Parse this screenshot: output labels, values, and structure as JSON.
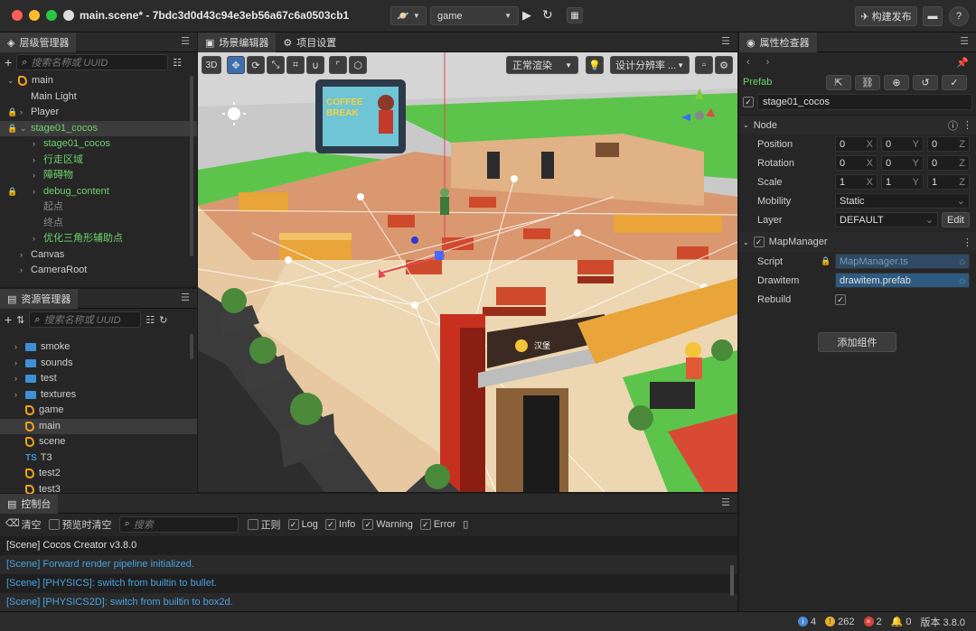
{
  "titlebar": {
    "title": "main.scene* - 7bdc3d0d43c94e3eb56a67c6a0503cb1",
    "platform": "game",
    "publish": "构建发布"
  },
  "hierarchy": {
    "tab": "层级管理器",
    "search_placeholder": "搜索名称或 UUID",
    "items": [
      {
        "label": "main"
      },
      {
        "label": "Main Light"
      },
      {
        "label": "Player"
      },
      {
        "label": "stage01_cocos"
      },
      {
        "label": "stage01_cocos"
      },
      {
        "label": "行走区域"
      },
      {
        "label": "障碍物"
      },
      {
        "label": "debug_content"
      },
      {
        "label": "起点"
      },
      {
        "label": "终点"
      },
      {
        "label": "优化三角形辅助点"
      },
      {
        "label": "Canvas"
      },
      {
        "label": "CameraRoot"
      }
    ]
  },
  "assets": {
    "tab": "资源管理器",
    "search_placeholder": "搜索名称或 UUID",
    "items": [
      {
        "label": "smoke"
      },
      {
        "label": "sounds"
      },
      {
        "label": "test"
      },
      {
        "label": "textures"
      },
      {
        "label": "game"
      },
      {
        "label": "main"
      },
      {
        "label": "scene"
      },
      {
        "label": "T3"
      },
      {
        "label": "test2"
      },
      {
        "label": "test3"
      }
    ]
  },
  "scene": {
    "tab_editor": "场景编辑器",
    "tab_settings": "项目设置",
    "btn_3d": "3D",
    "render_mode": "正常渲染",
    "resolution": "设计分辨率 ...",
    "sign_text": "COFFEE BREAK",
    "shop_text": "汉堡"
  },
  "console": {
    "tab": "控制台",
    "clear": "清空",
    "preview_clear": "预览时清空",
    "search_placeholder": "搜索",
    "regex": "正则",
    "log": "Log",
    "info": "Info",
    "warning": "Warning",
    "error": "Error",
    "lines": [
      "[Scene] Cocos Creator v3.8.0",
      "[Scene] Forward render pipeline initialized.",
      "[Scene] [PHYSICS]: switch from builtin to bullet.",
      "[Scene] [PHYSICS2D]: switch from builtin to box2d."
    ]
  },
  "inspector": {
    "tab": "属性检查器",
    "prefab": "Prefab",
    "node_name": "stage01_cocos",
    "node_section": "Node",
    "position_label": "Position",
    "position": [
      "0",
      "0",
      "0"
    ],
    "rotation_label": "Rotation",
    "rotation": [
      "0",
      "0",
      "0"
    ],
    "scale_label": "Scale",
    "scale": [
      "1",
      "1",
      "1"
    ],
    "axes": [
      "X",
      "Y",
      "Z"
    ],
    "mobility_label": "Mobility",
    "mobility": "Static",
    "layer_label": "Layer",
    "layer": "DEFAULT",
    "edit": "Edit",
    "component": "MapManager",
    "script_label": "Script",
    "script": "MapManager.ts",
    "drawitem_label": "Drawitem",
    "drawitem": "drawitem.prefab",
    "rebuild_label": "Rebuild",
    "add_component": "添加组件"
  },
  "statusbar": {
    "info": "4",
    "warn": "262",
    "error": "2",
    "notify": "0",
    "version": "版本 3.8.0"
  }
}
